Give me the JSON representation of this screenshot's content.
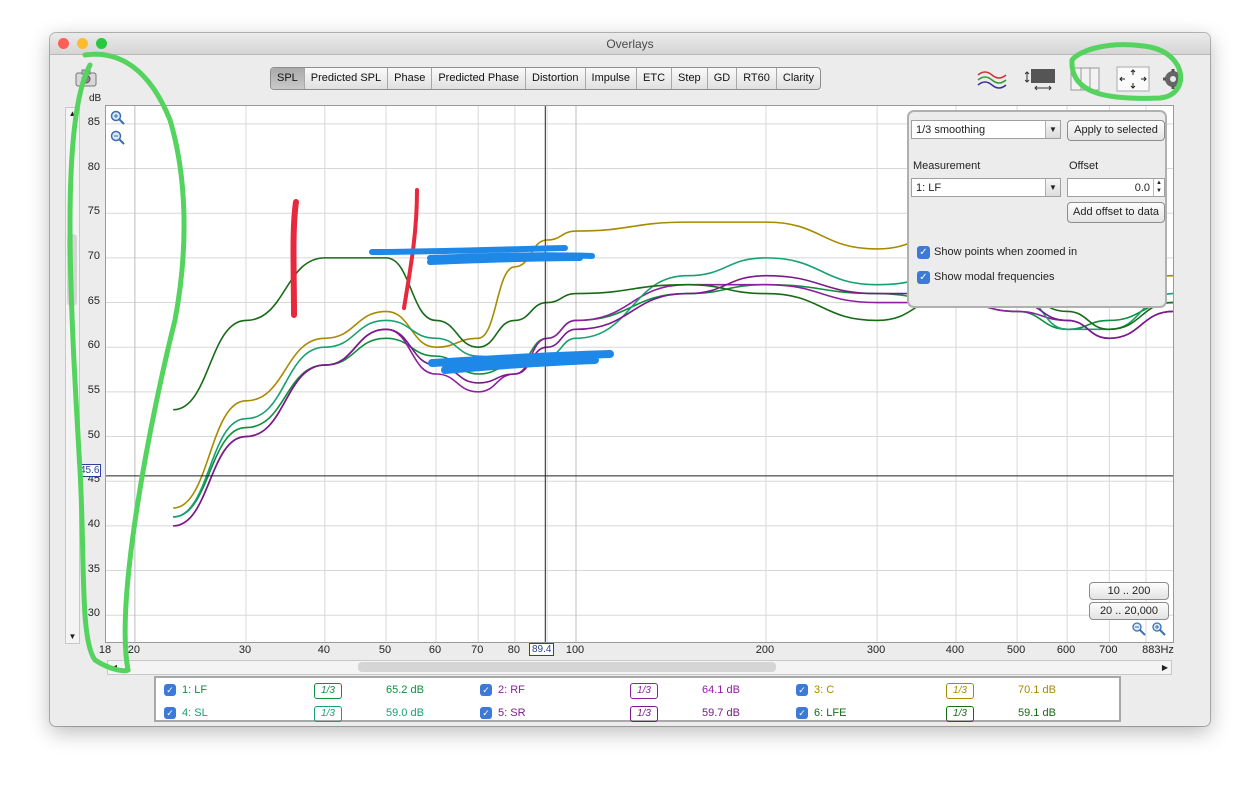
{
  "window": {
    "title": "Overlays"
  },
  "tabs": [
    "SPL",
    "Predicted SPL",
    "Phase",
    "Predicted Phase",
    "Distortion",
    "Impulse",
    "ETC",
    "Step",
    "GD",
    "RT60",
    "Clarity"
  ],
  "active_tab": "SPL",
  "y_axis": {
    "unit": "dB",
    "ticks": [
      "85",
      "80",
      "75",
      "70",
      "65",
      "60",
      "55",
      "50",
      "45",
      "40",
      "35",
      "30"
    ]
  },
  "x_axis": {
    "ticks": [
      "18",
      "20",
      "30",
      "40",
      "50",
      "60",
      "70",
      "80",
      "100",
      "200",
      "300",
      "400",
      "500",
      "600",
      "700",
      "883Hz"
    ]
  },
  "cursor": {
    "y_value": "45.6",
    "x_value": "89.4"
  },
  "controls": {
    "smoothing_value": "1/3 smoothing",
    "apply_button": "Apply to selected",
    "measurement_label": "Measurement",
    "measurement_value": "1: LF",
    "offset_label": "Offset",
    "offset_value": "0.0",
    "add_offset_button": "Add offset to data",
    "show_points_label": "Show points when zoomed in",
    "show_modal_label": "Show modal frequencies"
  },
  "zoom_buttons": {
    "range1": "10 .. 200",
    "range2": "20 .. 20,000"
  },
  "legend": [
    {
      "name": "1: LF",
      "smoothing": "1/3",
      "value": "65.2 dB",
      "color": "#0d8f3c"
    },
    {
      "name": "2: RF",
      "smoothing": "1/3",
      "value": "64.1 dB",
      "color": "#8e1fa0"
    },
    {
      "name": "3: C",
      "smoothing": "1/3",
      "value": "70.1 dB",
      "color": "#a88a00"
    },
    {
      "name": "4: SL",
      "smoothing": "1/3",
      "value": "59.0 dB",
      "color": "#18a070"
    },
    {
      "name": "5: SR",
      "smoothing": "1/3",
      "value": "59.7 dB",
      "color": "#7a1a8a"
    },
    {
      "name": "6: LFE",
      "smoothing": "1/3",
      "value": "59.1 dB",
      "color": "#166b16"
    }
  ],
  "chart_data": {
    "type": "line",
    "ylabel": "dB",
    "xlim": [
      18,
      883
    ],
    "ylim": [
      27,
      87
    ],
    "x_scale": "log",
    "grid": true,
    "series": [
      {
        "name": "1: LF",
        "color": "#0d8f3c",
        "x": [
          23,
          30,
          40,
          50,
          60,
          70,
          80,
          90,
          100,
          150,
          200,
          300,
          400,
          500,
          600,
          700,
          883
        ],
        "y": [
          41,
          51,
          58,
          61,
          59,
          57,
          58,
          61,
          63,
          66,
          67,
          66,
          65,
          64,
          62,
          63,
          65
        ]
      },
      {
        "name": "2: RF",
        "color": "#8e1fa0",
        "x": [
          23,
          30,
          40,
          50,
          60,
          70,
          80,
          90,
          100,
          150,
          200,
          300,
          400,
          500,
          600,
          700,
          883
        ],
        "y": [
          40,
          50,
          58,
          62,
          57,
          55,
          57,
          61,
          63,
          67,
          67,
          65,
          65,
          64,
          63,
          61,
          64
        ]
      },
      {
        "name": "3: C",
        "color": "#a88a00",
        "x": [
          23,
          30,
          40,
          50,
          60,
          70,
          80,
          90,
          100,
          150,
          200,
          300,
          400,
          500,
          600,
          700,
          883
        ],
        "y": [
          42,
          54,
          61,
          64,
          60,
          61,
          69,
          72,
          73,
          74,
          74,
          71,
          73,
          72,
          70,
          67,
          68
        ]
      },
      {
        "name": "4: SL",
        "color": "#18a070",
        "x": [
          23,
          30,
          40,
          50,
          60,
          70,
          80,
          90,
          100,
          150,
          200,
          300,
          400,
          500,
          600,
          700,
          883
        ],
        "y": [
          41,
          52,
          60,
          63,
          61,
          59,
          58,
          59,
          61,
          68,
          70,
          67,
          68,
          66,
          62,
          62,
          66
        ]
      },
      {
        "name": "5: SR",
        "color": "#7a1a8a",
        "x": [
          23,
          30,
          40,
          50,
          60,
          70,
          80,
          90,
          100,
          150,
          200,
          300,
          400,
          500,
          600,
          700,
          883
        ],
        "y": [
          40,
          50,
          58,
          62,
          58,
          56,
          57,
          60,
          62,
          66,
          68,
          66,
          66,
          65,
          63,
          61,
          64
        ]
      },
      {
        "name": "6: LFE",
        "color": "#166b16",
        "x": [
          23,
          30,
          40,
          50,
          60,
          70,
          80,
          90,
          100,
          150,
          200,
          300,
          400,
          500,
          600,
          700,
          883
        ],
        "y": [
          53,
          63,
          70,
          70,
          63,
          60,
          63,
          65,
          66,
          67,
          66,
          63,
          66,
          66,
          64,
          62,
          65
        ]
      }
    ]
  }
}
